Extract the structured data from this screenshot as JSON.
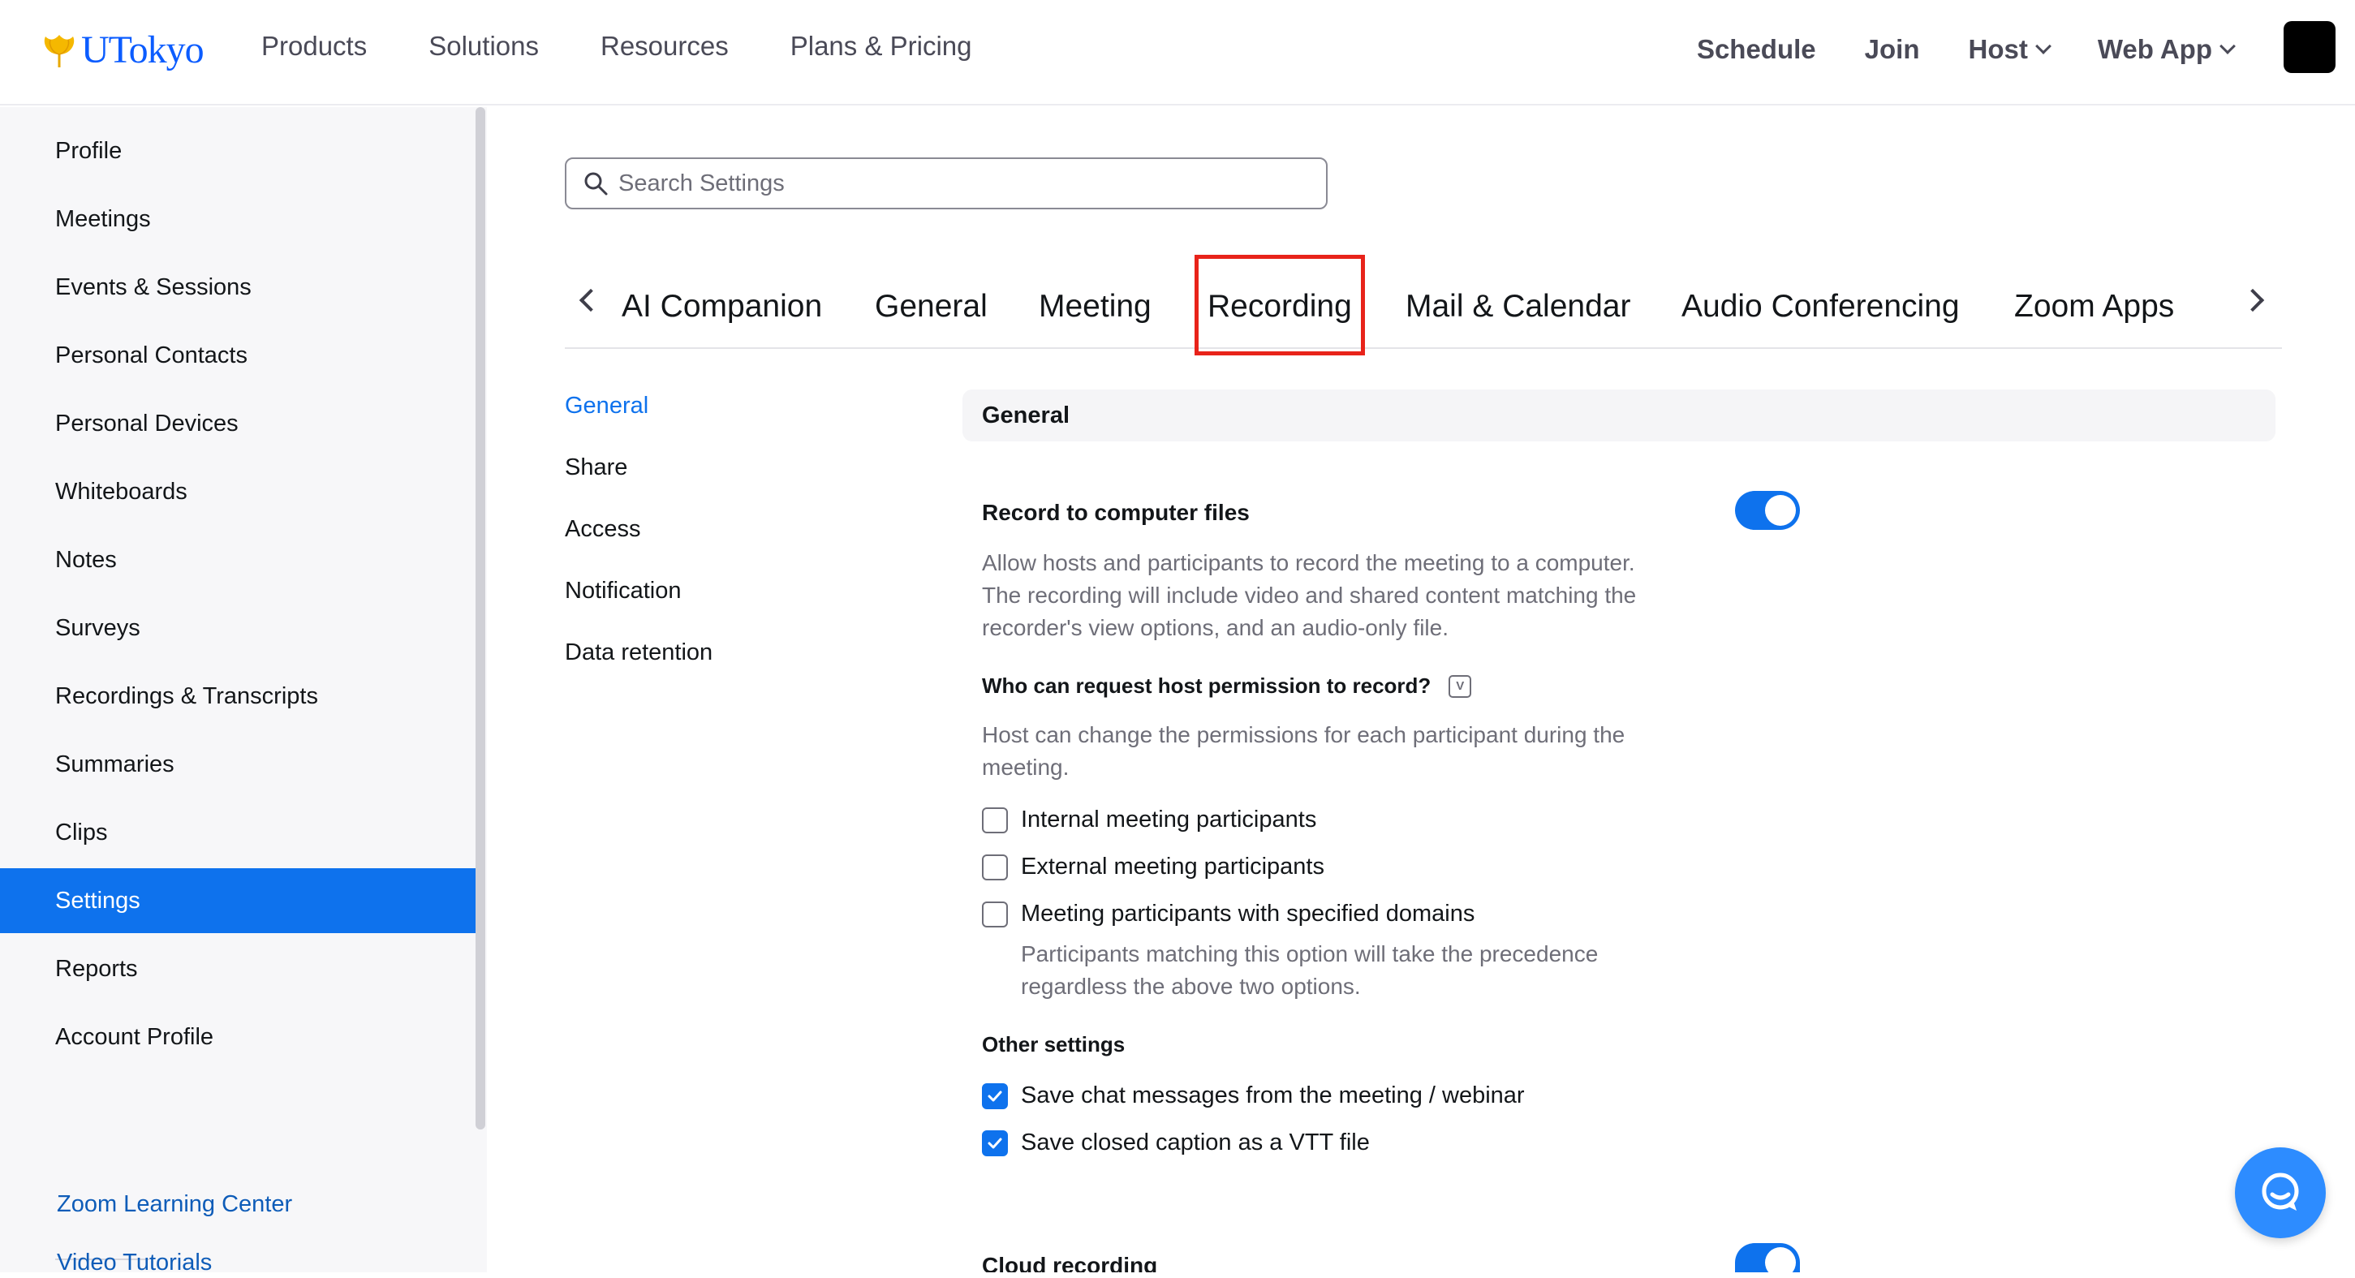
{
  "brand": {
    "name": "UTokyo",
    "color": "#0b5cff"
  },
  "top_nav": {
    "left": [
      "Products",
      "Solutions",
      "Resources",
      "Plans & Pricing"
    ],
    "schedule": "Schedule",
    "join": "Join",
    "host": "Host",
    "web_app": "Web App"
  },
  "sidebar": {
    "items": [
      {
        "label": "Profile"
      },
      {
        "label": "Meetings"
      },
      {
        "label": "Events & Sessions"
      },
      {
        "label": "Personal Contacts"
      },
      {
        "label": "Personal Devices"
      },
      {
        "label": "Whiteboards"
      },
      {
        "label": "Notes"
      },
      {
        "label": "Surveys"
      },
      {
        "label": "Recordings & Transcripts"
      },
      {
        "label": "Summaries"
      },
      {
        "label": "Clips"
      },
      {
        "label": "Settings",
        "active": true
      },
      {
        "label": "Reports"
      },
      {
        "label": "Account Profile"
      }
    ],
    "links": [
      "Zoom Learning Center",
      "Video Tutorials"
    ]
  },
  "search": {
    "placeholder": "Search Settings",
    "value": ""
  },
  "tabs": [
    "AI Companion",
    "General",
    "Meeting",
    "Recording",
    "Mail & Calendar",
    "Audio Conferencing",
    "Zoom Apps"
  ],
  "selected_tab": "Recording",
  "subnav": [
    "General",
    "Share",
    "Access",
    "Notification",
    "Data retention"
  ],
  "content": {
    "section_title": "General",
    "record_local": {
      "title": "Record to computer files",
      "enabled": true,
      "desc": [
        "Allow hosts and participants to record the meeting to a computer.",
        "The recording will include video and shared content matching the",
        "recorder's view options, and an audio-only file."
      ]
    },
    "permission": {
      "title": "Who can request host permission to record?",
      "info_glyph": "V",
      "desc": [
        "Host can change the permissions for each participant during the",
        "meeting."
      ],
      "options": [
        {
          "label": "Internal meeting participants",
          "checked": false
        },
        {
          "label": "External meeting participants",
          "checked": false
        },
        {
          "label": "Meeting participants with specified domains",
          "checked": false
        }
      ],
      "domains_note": [
        "Participants matching this option will take the precedence",
        "regardless the above two options."
      ]
    },
    "other": {
      "title": "Other settings",
      "options": [
        {
          "label": "Save chat messages from the meeting / webinar",
          "checked": true
        },
        {
          "label": "Save closed caption as a VTT file",
          "checked": true
        }
      ]
    },
    "cloud": {
      "title": "Cloud recording",
      "enabled": true
    }
  },
  "colors": {
    "accent": "#0e72ed",
    "highlight": "#e8231a",
    "chat_fab": "#2d8cff"
  }
}
